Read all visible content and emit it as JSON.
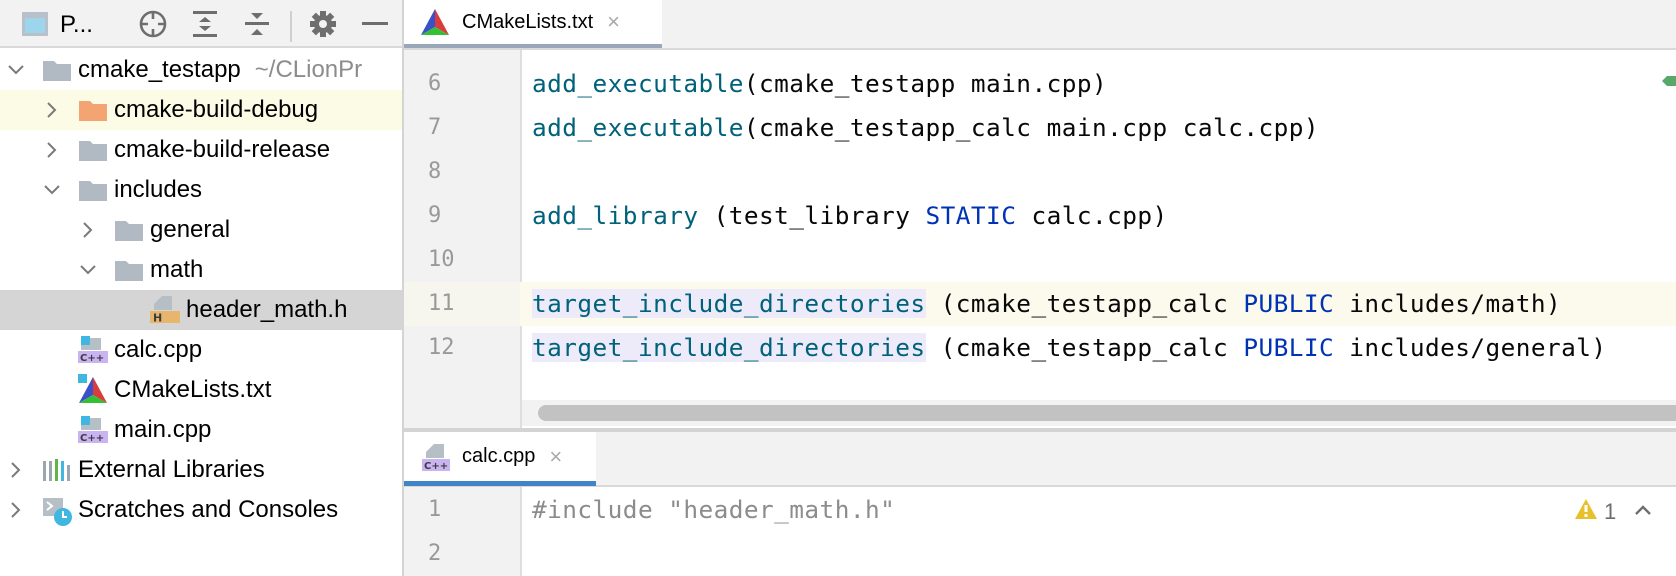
{
  "project_panel": {
    "title": "P...",
    "toolbar_icons": [
      "project-view-icon",
      "locate-icon",
      "expand-all-icon",
      "collapse-all-icon",
      "gear-icon",
      "minimize-icon"
    ],
    "tree": [
      {
        "label": "cmake_testapp",
        "path": "~/CLionPr",
        "icon": "folder",
        "expanded": true,
        "level": 0
      },
      {
        "label": "cmake-build-debug",
        "icon": "folder-orange",
        "expanded": false,
        "level": 1
      },
      {
        "label": "cmake-build-release",
        "icon": "folder",
        "expanded": false,
        "level": 1
      },
      {
        "label": "includes",
        "icon": "folder",
        "expanded": true,
        "level": 1
      },
      {
        "label": "general",
        "icon": "folder",
        "expanded": false,
        "level": 2
      },
      {
        "label": "math",
        "icon": "folder",
        "expanded": true,
        "level": 2
      },
      {
        "label": "header_math.h",
        "icon": "header-file",
        "level": 3,
        "selected": true
      },
      {
        "label": "calc.cpp",
        "icon": "cpp-file",
        "level": 1
      },
      {
        "label": "CMakeLists.txt",
        "icon": "cmake-file",
        "level": 1
      },
      {
        "label": "main.cpp",
        "icon": "cpp-file",
        "level": 1
      },
      {
        "label": "External Libraries",
        "icon": "libraries",
        "expanded": false,
        "level": 0
      },
      {
        "label": "Scratches and Consoles",
        "icon": "scratches",
        "expanded": false,
        "level": 0
      }
    ]
  },
  "top_editor": {
    "tab": {
      "label": "CMakeLists.txt",
      "close": "×"
    },
    "lines": [
      {
        "n": "6",
        "tokens": [
          {
            "t": "add_executable",
            "c": "fn"
          },
          {
            "t": "(cmake_testapp main.cpp)",
            "c": ""
          }
        ]
      },
      {
        "n": "7",
        "tokens": [
          {
            "t": "add_executable",
            "c": "fn"
          },
          {
            "t": "(cmake_testapp_calc main.cpp calc.cpp)",
            "c": ""
          }
        ]
      },
      {
        "n": "8",
        "tokens": []
      },
      {
        "n": "9",
        "tokens": [
          {
            "t": "add_library",
            "c": "fn"
          },
          {
            "t": " (test_library ",
            "c": ""
          },
          {
            "t": "STATIC",
            "c": "kw"
          },
          {
            "t": " calc.cpp)",
            "c": ""
          }
        ]
      },
      {
        "n": "10",
        "tokens": []
      },
      {
        "n": "11",
        "tokens": [
          {
            "t": "target_include_directories",
            "c": "fn fn-hl"
          },
          {
            "t": " (cmake_testapp_calc ",
            "c": ""
          },
          {
            "t": "PUBLIC",
            "c": "kw"
          },
          {
            "t": " includes/math)",
            "c": ""
          }
        ]
      },
      {
        "n": "12",
        "tokens": [
          {
            "t": "target_include_directories",
            "c": "fn fn-hl"
          },
          {
            "t": " (cmake_testapp_calc ",
            "c": ""
          },
          {
            "t": "PUBLIC",
            "c": "kw"
          },
          {
            "t": " includes/general)",
            "c": ""
          }
        ]
      }
    ],
    "current_line": "11"
  },
  "bottom_editor": {
    "tab": {
      "label": "calc.cpp",
      "close": "×"
    },
    "lines": [
      {
        "n": "1",
        "tokens": [
          {
            "t": "#include \"header_math.h\"",
            "c": "cmt"
          }
        ]
      },
      {
        "n": "2",
        "tokens": []
      }
    ],
    "warnings": {
      "count": "1"
    }
  },
  "colors": {
    "function": "#00627a",
    "keyword": "#0033b3",
    "tab_underline_active": "#4083c9",
    "tab_underline_inactive": "#9aa7b9",
    "selection_row": "#d5d5d5",
    "warning": "#e8c02c"
  }
}
